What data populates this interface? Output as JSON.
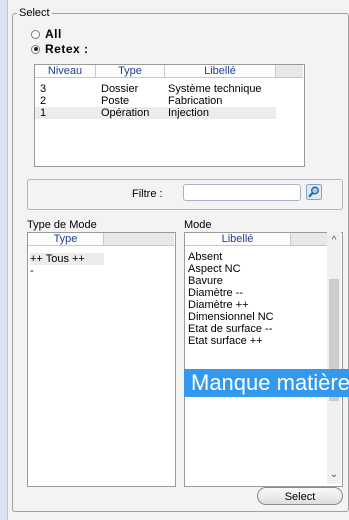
{
  "select_group": {
    "legend": "Select"
  },
  "radios": [
    {
      "label": "All",
      "checked": false
    },
    {
      "label": "Retex :",
      "checked": true
    }
  ],
  "retex_table": {
    "columns": [
      "Niveau",
      "Type",
      "Libellé"
    ],
    "rows": [
      {
        "niveau": "3",
        "type": "Dossier",
        "libelle": "Système technique"
      },
      {
        "niveau": "2",
        "type": "Poste",
        "libelle": "Fabrication"
      },
      {
        "niveau": "1",
        "type": "Opération",
        "libelle": "Injection",
        "selected": true
      }
    ]
  },
  "filter": {
    "label": "Filtre :",
    "value": ""
  },
  "type_de_mode": {
    "label": "Type de Mode",
    "column": "Type",
    "items": [
      "++ Tous ++",
      "-"
    ]
  },
  "mode": {
    "label": "Mode",
    "column": "Libellé",
    "items": [
      "Absent",
      "Aspect NC",
      "Bavure",
      "Diamètre --",
      "Diamètre ++",
      "Dimensionnel NC",
      "Etat de surface --",
      "Etat surface ++"
    ],
    "highlighted_item": "Manque matière"
  },
  "select_button": {
    "label": "Select"
  },
  "colors": {
    "highlight": "#3399ee",
    "header_text": "#1f3f8f"
  }
}
